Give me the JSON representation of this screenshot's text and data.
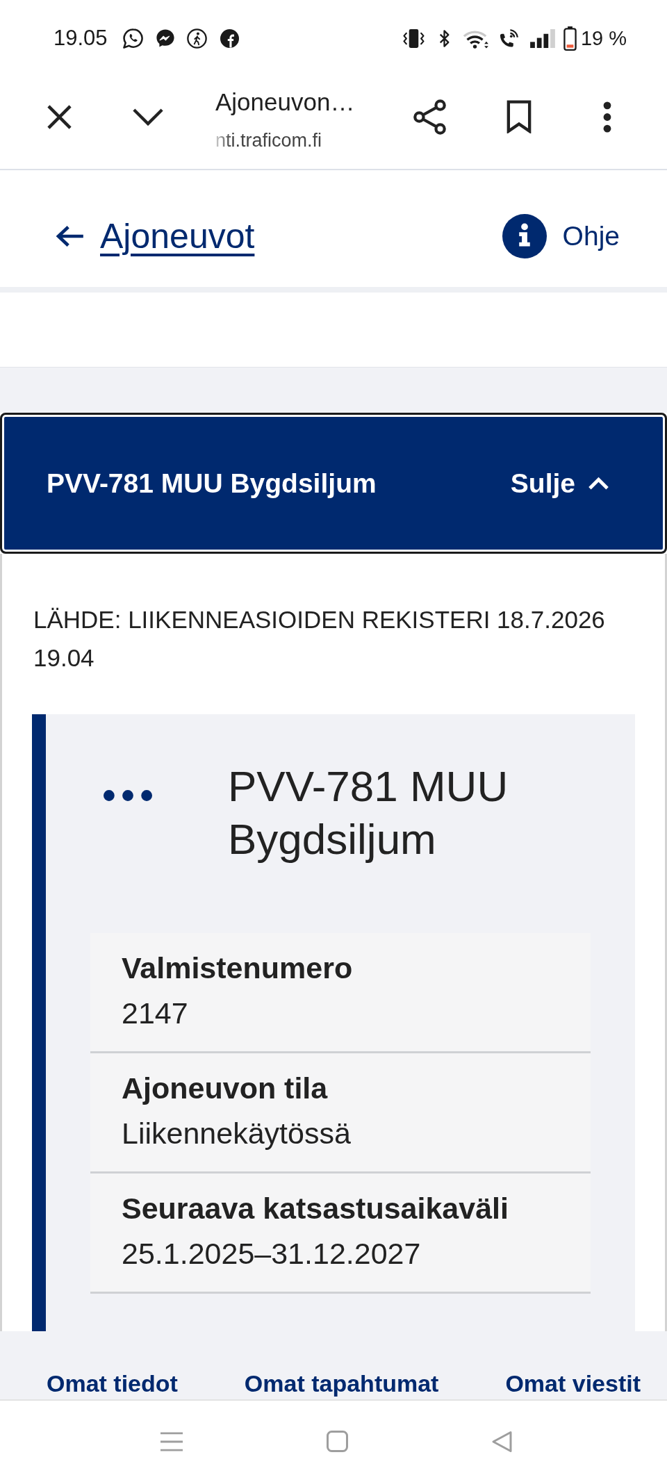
{
  "status_bar": {
    "time": "19.05",
    "battery": "19 %"
  },
  "browser_bar": {
    "title": "Ajoneuvon…",
    "url": "nti.traficom.fi"
  },
  "header": {
    "back_link": "Ajoneuvot",
    "help": "Ohje"
  },
  "accordion": {
    "title": "PVV-781 MUU Bygdsiljum",
    "toggle": "Sulje",
    "expanded": true
  },
  "source": "LÄHDE: LIIKENNEASIOIDEN REKISTERI 18.7.2026 19.04",
  "vehicle_card": {
    "title": "PVV-781 MUU Bygdsiljum",
    "fields": [
      {
        "label": "Valmistenumero",
        "value": "2147"
      },
      {
        "label": "Ajoneuvon tila",
        "value": "Liikennekäytössä"
      },
      {
        "label": "Seuraava katsastusaikaväli",
        "value": "25.1.2025–31.12.2027"
      }
    ]
  },
  "bottom_nav": [
    "Omat tiedot",
    "Omat tapahtumat",
    "Omat viestit"
  ]
}
